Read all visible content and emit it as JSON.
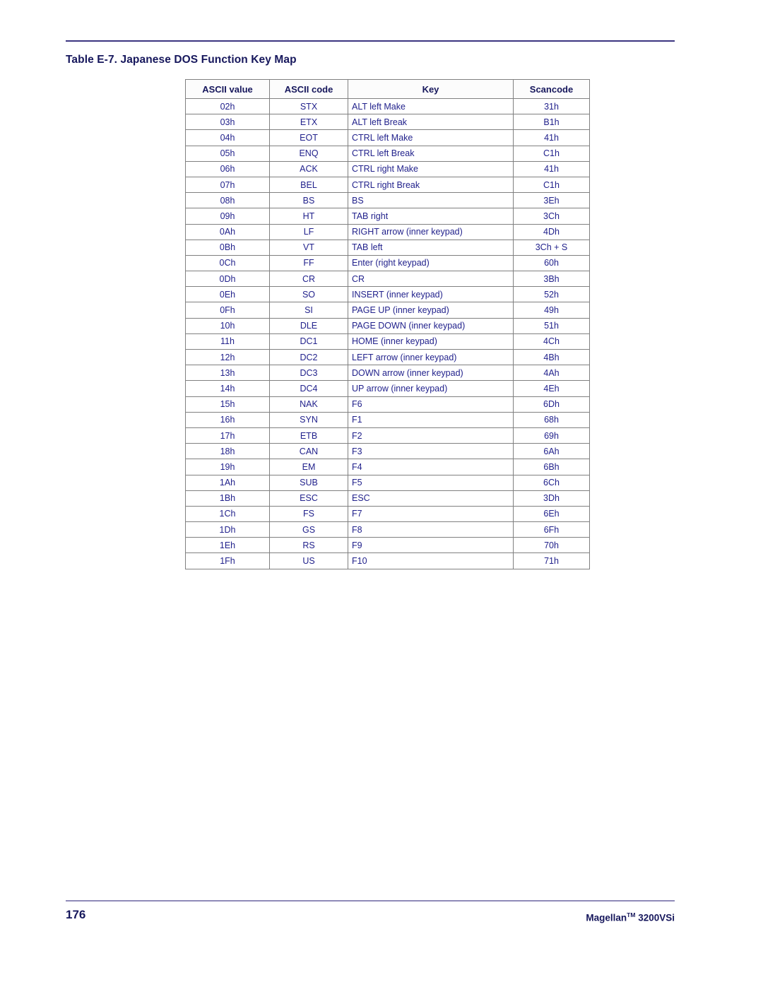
{
  "document": {
    "table_caption": "Table E-7. Japanese DOS Function Key Map",
    "footer": {
      "page_number": "176",
      "brand_name": "Magellan",
      "trademark_symbol": "TM",
      "model": " 3200VSi"
    },
    "colors": {
      "text_navy": "#22228c",
      "heading_navy": "#16175c",
      "top_rule": "#3b3580",
      "footer_rule": "#8f8ab8",
      "table_border": "#808080"
    }
  },
  "chart_data": {
    "type": "table",
    "title": "Table E-7. Japanese DOS Function Key Map",
    "columns": [
      "ASCII value",
      "ASCII code",
      "Key",
      "Scancode"
    ],
    "rows": [
      [
        "02h",
        "STX",
        "ALT left Make",
        "31h"
      ],
      [
        "03h",
        "ETX",
        "ALT left Break",
        "B1h"
      ],
      [
        "04h",
        "EOT",
        "CTRL left Make",
        "41h"
      ],
      [
        "05h",
        "ENQ",
        "CTRL left Break",
        "C1h"
      ],
      [
        "06h",
        "ACK",
        "CTRL right Make",
        "41h"
      ],
      [
        "07h",
        "BEL",
        "CTRL right Break",
        "C1h"
      ],
      [
        "08h",
        "BS",
        "BS",
        "3Eh"
      ],
      [
        "09h",
        "HT",
        "TAB right",
        "3Ch"
      ],
      [
        "0Ah",
        "LF",
        "RIGHT arrow (inner keypad)",
        "4Dh"
      ],
      [
        "0Bh",
        "VT",
        "TAB left",
        "3Ch + S"
      ],
      [
        "0Ch",
        "FF",
        "Enter (right keypad)",
        "60h"
      ],
      [
        "0Dh",
        "CR",
        "CR",
        "3Bh"
      ],
      [
        "0Eh",
        "SO",
        "INSERT (inner keypad)",
        "52h"
      ],
      [
        "0Fh",
        "SI",
        "PAGE UP (inner keypad)",
        "49h"
      ],
      [
        "10h",
        "DLE",
        "PAGE DOWN (inner keypad)",
        "51h"
      ],
      [
        "11h",
        "DC1",
        "HOME (inner keypad)",
        "4Ch"
      ],
      [
        "12h",
        "DC2",
        "LEFT arrow (inner keypad)",
        "4Bh"
      ],
      [
        "13h",
        "DC3",
        "DOWN arrow (inner keypad)",
        "4Ah"
      ],
      [
        "14h",
        "DC4",
        "UP arrow (inner keypad)",
        "4Eh"
      ],
      [
        "15h",
        "NAK",
        "F6",
        "6Dh"
      ],
      [
        "16h",
        "SYN",
        "F1",
        "68h"
      ],
      [
        "17h",
        "ETB",
        "F2",
        "69h"
      ],
      [
        "18h",
        "CAN",
        "F3",
        "6Ah"
      ],
      [
        "19h",
        "EM",
        "F4",
        "6Bh"
      ],
      [
        "1Ah",
        "SUB",
        "F5",
        "6Ch"
      ],
      [
        "1Bh",
        "ESC",
        "ESC",
        "3Dh"
      ],
      [
        "1Ch",
        "FS",
        "F7",
        "6Eh"
      ],
      [
        "1Dh",
        "GS",
        "F8",
        "6Fh"
      ],
      [
        "1Eh",
        "RS",
        "F9",
        "70h"
      ],
      [
        "1Fh",
        "US",
        "F10",
        "71h"
      ]
    ]
  }
}
